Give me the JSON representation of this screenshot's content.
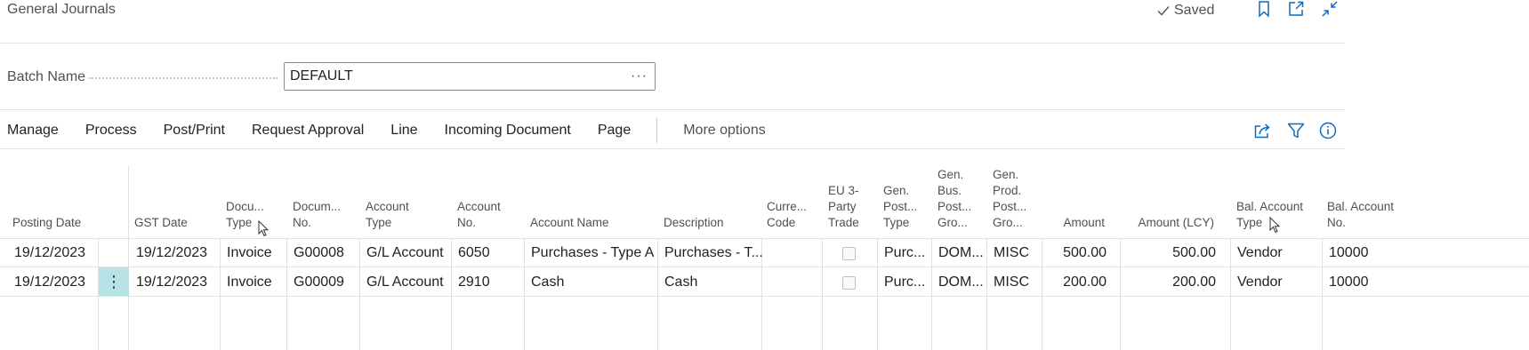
{
  "page": {
    "title": "General Journals",
    "saved_label": "Saved",
    "icons": [
      "checkmark-icon",
      "bookmark-icon",
      "open-new-window-icon",
      "collapse-icon"
    ]
  },
  "batch": {
    "label": "Batch Name",
    "value": "DEFAULT",
    "lookup": "···"
  },
  "actions": {
    "items": [
      "Manage",
      "Process",
      "Post/Print",
      "Request Approval",
      "Line",
      "Incoming Document",
      "Page"
    ],
    "more": "More options",
    "right_icons": [
      "share-icon",
      "filter-icon",
      "info-icon"
    ]
  },
  "table": {
    "headers": [
      [
        "Posting Date"
      ],
      [
        "GST Date"
      ],
      [
        "Docu...",
        "Type"
      ],
      [
        "Docum...",
        "No."
      ],
      [
        "Account",
        "Type"
      ],
      [
        "Account",
        "No."
      ],
      [
        "Account Name"
      ],
      [
        "Description"
      ],
      [
        "Curre...",
        "Code"
      ],
      [
        "EU 3-",
        "Party",
        "Trade"
      ],
      [
        "Gen.",
        "Post...",
        "Type"
      ],
      [
        "Gen.",
        "Bus.",
        "Post...",
        "Gro..."
      ],
      [
        "Gen.",
        "Prod.",
        "Post...",
        "Gro..."
      ],
      [
        "Amount"
      ],
      [
        "Amount (LCY)"
      ],
      [
        "Bal. Account",
        "Type"
      ],
      [
        "Bal. Account",
        "No."
      ]
    ],
    "rows": [
      {
        "posting_date": "19/12/2023",
        "gst_date": "19/12/2023",
        "doc_type": "Invoice",
        "doc_no": "G00008",
        "account_type": "G/L Account",
        "account_no": "6050",
        "account_name": "Purchases - Type A",
        "description": "Purchases - T...",
        "currency": "",
        "eu3": false,
        "gen_post_type": "Purc...",
        "gen_bus": "DOM...",
        "gen_prod": "MISC",
        "amount": "500.00",
        "amount_lcy": "500.00",
        "bal_type": "Vendor",
        "bal_no": "10000"
      },
      {
        "posting_date": "19/12/2023",
        "gst_date": "19/12/2023",
        "doc_type": "Invoice",
        "doc_no": "G00009",
        "account_type": "G/L Account",
        "account_no": "2910",
        "account_name": "Cash",
        "description": "Cash",
        "currency": "",
        "eu3": false,
        "gen_post_type": "Purc...",
        "gen_bus": "DOM...",
        "gen_prod": "MISC",
        "amount": "200.00",
        "amount_lcy": "200.00",
        "bal_type": "Vendor",
        "bal_no": "10000"
      }
    ],
    "row_menu_glyph": "⋮"
  },
  "colors": {
    "accent": "#0f6cbd",
    "row_selected": "#b7e3e7",
    "text_muted": "#505050"
  }
}
